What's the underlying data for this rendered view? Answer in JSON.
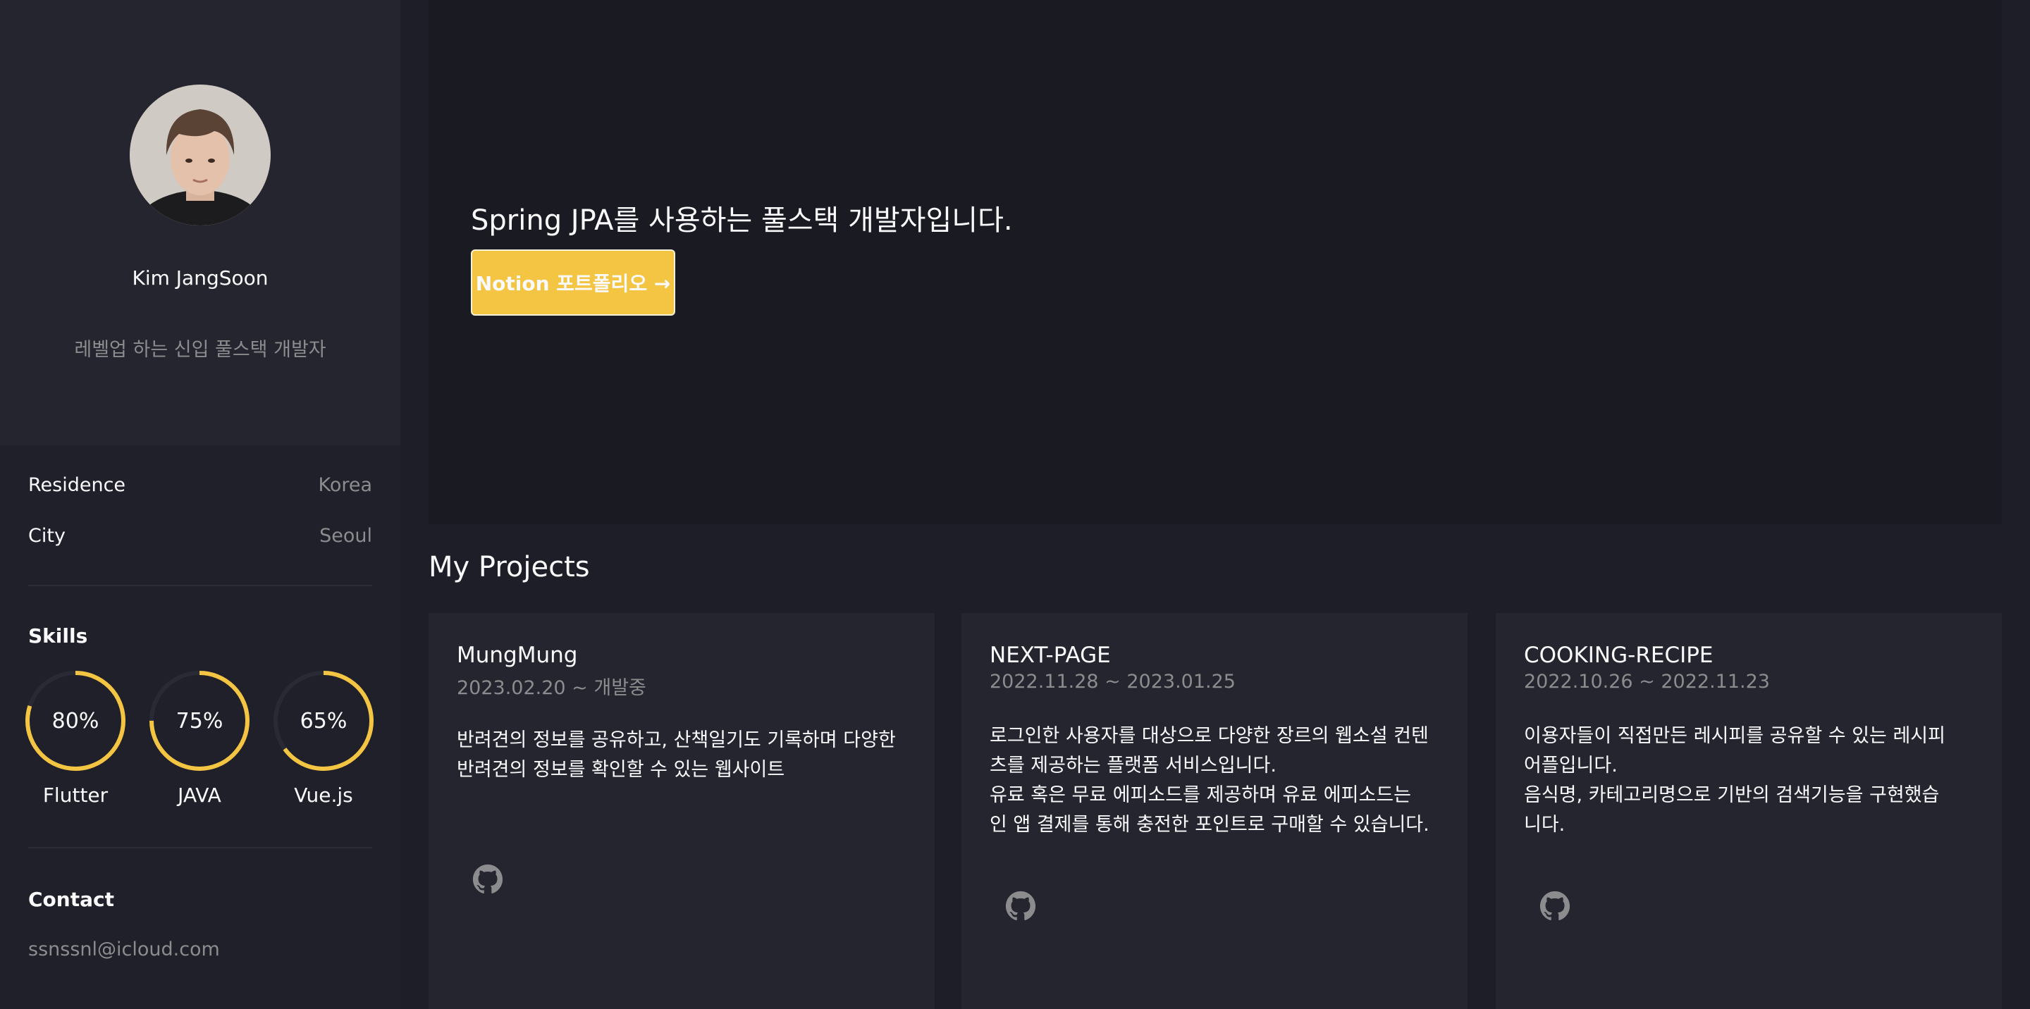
{
  "profile": {
    "name": "Kim JangSoon",
    "role": "레벨업 하는 신입 풀스택 개발자"
  },
  "info": [
    {
      "label": "Residence",
      "value": "Korea"
    },
    {
      "label": "City",
      "value": "Seoul"
    }
  ],
  "skills": {
    "title": "Skills",
    "items": [
      {
        "name": "Flutter",
        "percent_label": "80%",
        "percent": 80
      },
      {
        "name": "JAVA",
        "percent_label": "75%",
        "percent": 75
      },
      {
        "name": "Vue.js",
        "percent_label": "65%",
        "percent": 65
      }
    ]
  },
  "contact": {
    "title": "Contact",
    "email": "ssnssnl@icloud.com"
  },
  "hero": {
    "text": "Spring JPA를 사용하는 풀스택 개발자입니다.",
    "button_label": "Notion 포트폴리오 →"
  },
  "projects": {
    "title": "My Projects",
    "items": [
      {
        "title": "MungMung",
        "date": "2023.02.20 ~ 개발중",
        "description": "반려견의 정보를 공유하고, 산책일기도 기록하며 다양한\n반려견의 정보를 확인할 수 있는 웹사이트"
      },
      {
        "title": "NEXT-PAGE",
        "date": "2022.11.28 ~ 2023.01.25",
        "description": "로그인한 사용자를 대상으로 다양한 장르의 웹소설 컨텐\n츠를 제공하는 플랫폼 서비스입니다.\n 유료 혹은 무료 에피소드를 제공하며 유료 에피소드는\n인 앱 결제를 통해 충전한 포인트로 구매할 수 있습니다."
      },
      {
        "title": "COOKING-RECIPE",
        "date": "2022.10.26 ~ 2022.11.23",
        "description": "이용자들이 직접만든 레시피를 공유할 수 있는 레시피\n어플입니다.\n    음식명, 카테고리명으로 기반의 검색기능을 구현했습\n니다."
      }
    ]
  },
  "colors": {
    "accent": "#f4c542",
    "background": "#1e1e28",
    "panel": "#252530",
    "muted_text": "#8c8c8e"
  },
  "icons": {
    "project_link": "github-icon"
  }
}
